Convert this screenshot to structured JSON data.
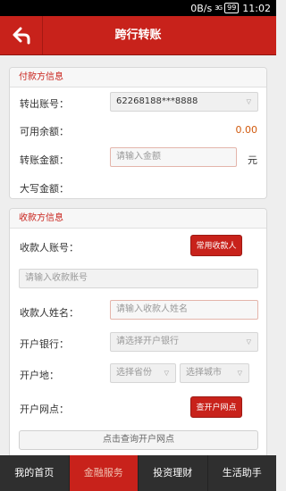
{
  "status_bar": {
    "speed": "0B/s",
    "signal": "3G",
    "battery": "99",
    "time": "11:02"
  },
  "header": {
    "title": "跨行转账",
    "back_icon": "back-arrow-icon"
  },
  "payer": {
    "section_title": "付款方信息",
    "account_label": "转出账号：",
    "account_value": "62268188***8888",
    "balance_label": "可用余额：",
    "balance_value": "0.00",
    "amount_label": "转账金额：",
    "amount_placeholder": "请输入金额",
    "amount_unit": "元",
    "uppercase_label": "大写金额："
  },
  "payee": {
    "section_title": "收款方信息",
    "account_label": "收款人账号：",
    "frequent_button": "常用收款人",
    "account_placeholder": "请输入收款账号",
    "name_label": "收款人姓名：",
    "name_placeholder": "请输入收款人姓名",
    "bank_label": "开户银行：",
    "bank_placeholder": "请选择开户银行",
    "location_label": "开户地：",
    "province_placeholder": "选择省份",
    "city_placeholder": "选择城市",
    "branch_label": "开户网点：",
    "branch_button": "查开户网点",
    "query_link": "点击查询开户网点"
  },
  "bottom_nav": [
    {
      "label": "我的首页",
      "active": false
    },
    {
      "label": "金融服务",
      "active": true
    },
    {
      "label": "投资理财",
      "active": false
    },
    {
      "label": "生活助手",
      "active": false
    }
  ],
  "colors": {
    "brand_red": "#c8221b",
    "amount_orange": "#d15a0e",
    "nav_dark": "#2f2f2f"
  }
}
